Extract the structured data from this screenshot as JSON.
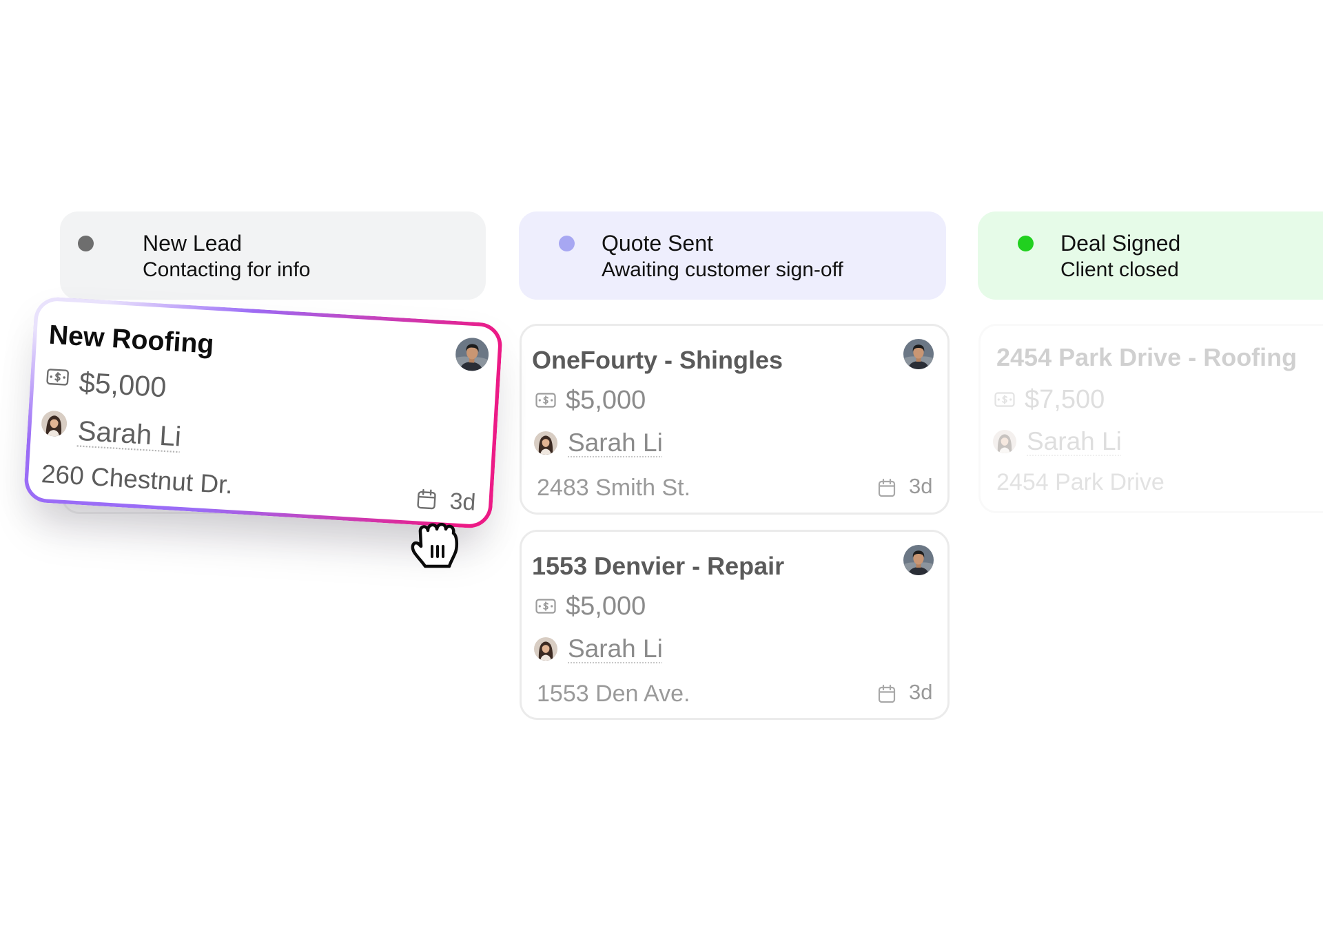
{
  "columns": [
    {
      "title": "New Lead",
      "subtitle": "Contacting for info",
      "status_color": "#6e6e6e",
      "header_color": "#f2f3f4",
      "cards": [
        {
          "title": "New Roofing",
          "amount": "$5,000",
          "assignee": "Sarah Li",
          "address": "260 Chestnut Dr.",
          "age": "3d",
          "amount_icon": "money-icon",
          "age_icon": "calendar-icon",
          "border_gradient": [
            "#e9e2fc",
            "#9a6cf6",
            "#ec1a86"
          ]
        }
      ]
    },
    {
      "title": "Quote Sent",
      "subtitle": "Awaiting customer sign-off",
      "status_color": "#a7a7f2",
      "header_color": "#eeeefd",
      "cards": [
        {
          "title": "OneFourty - Shingles",
          "amount": "$5,000",
          "assignee": "Sarah Li",
          "address": "2483 Smith St.",
          "age": "3d",
          "amount_icon": "money-icon",
          "age_icon": "calendar-icon"
        },
        {
          "title": "1553 Denvier - Repair",
          "amount": "$5,000",
          "assignee": "Sarah Li",
          "address": "1553 Den Ave.",
          "age": "3d",
          "amount_icon": "money-icon",
          "age_icon": "calendar-icon"
        }
      ]
    },
    {
      "title": "Deal Signed",
      "subtitle": "Client closed",
      "status_color": "#21d01f",
      "header_color": "#e6fbe8",
      "cards": [
        {
          "title": "2454 Park Drive - Roofing",
          "amount": "$7,500",
          "assignee": "Sarah Li",
          "address": "2454 Park Drive",
          "amount_icon": "money-icon"
        }
      ]
    }
  ],
  "cursor": {
    "icon": "grab-cursor-icon"
  }
}
